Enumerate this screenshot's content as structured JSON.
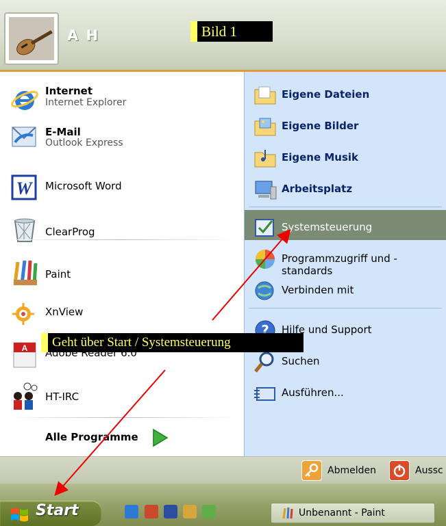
{
  "header": {
    "username": "A H",
    "annotation_title": "Bild 1"
  },
  "programs": [
    {
      "title": "Internet",
      "subtitle": "Internet Explorer",
      "icon": "internet-explorer-icon"
    },
    {
      "title": "E-Mail",
      "subtitle": "Outlook Express",
      "icon": "outlook-express-icon"
    },
    {
      "title": "Microsoft Word",
      "icon": "word-icon"
    },
    {
      "title": "ClearProg",
      "icon": "recycle-bin-icon"
    },
    {
      "title": "Paint",
      "icon": "paint-icon"
    },
    {
      "title": "XnView",
      "icon": "xnview-icon"
    },
    {
      "title": "Adobe Reader 6.0",
      "icon": "adobe-reader-icon"
    },
    {
      "title": "HT-IRC",
      "icon": "chat-users-icon"
    }
  ],
  "all_programs": "Alle Programme",
  "places": [
    {
      "label": "Eigene Dateien",
      "icon": "documents-folder-icon"
    },
    {
      "label": "Eigene Bilder",
      "icon": "pictures-folder-icon"
    },
    {
      "label": "Eigene Musik",
      "icon": "music-folder-icon"
    },
    {
      "label": "Arbeitsplatz",
      "icon": "computer-icon"
    }
  ],
  "system": [
    {
      "label": "Systemsteuerung",
      "icon": "control-panel-icon",
      "highlighted": true
    },
    {
      "label": "Programmzugriff und -standards",
      "icon": "program-access-icon"
    },
    {
      "label": "Verbinden mit",
      "icon": "connect-icon"
    }
  ],
  "help": [
    {
      "label": "Hilfe und Support",
      "icon": "help-icon"
    },
    {
      "label": "Suchen",
      "icon": "search-icon"
    },
    {
      "label": "Ausführen...",
      "icon": "run-icon"
    }
  ],
  "footer": {
    "logoff": "Abmelden",
    "shutdown": "Aussc"
  },
  "taskbar": {
    "start": "Start",
    "task": "Unbenannt - Paint"
  },
  "annotation": {
    "note": "Geht  über Start / Systemsteuerung"
  }
}
